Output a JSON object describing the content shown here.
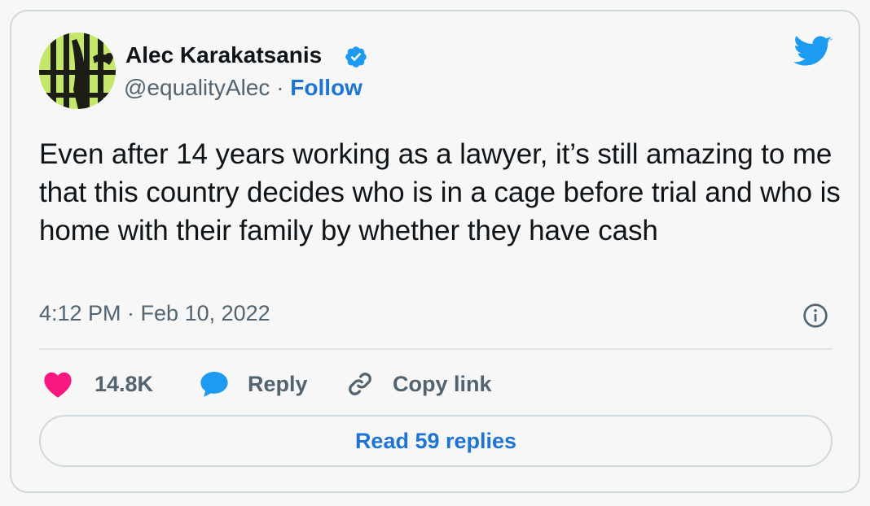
{
  "author": {
    "name": "Alec Karakatsanis",
    "handle": "@equalityAlec",
    "separator": "·",
    "follow_label": "Follow"
  },
  "tweet": {
    "text": "Even after 14 years working as a lawyer, it’s still amazing to me that this country decides who is in a cage before trial and who is home with their family by whether they have cash",
    "timestamp": "4:12 PM · Feb 10, 2022"
  },
  "actions": {
    "likes_count": "14.8K",
    "reply_label": "Reply",
    "copy_link_label": "Copy link"
  },
  "read_replies_label": "Read 59 replies",
  "colors": {
    "accent": "#1d74d3",
    "twitter_blue": "#1d9bf0",
    "like": "#f91880",
    "muted_text": "#536471",
    "border": "#cfd9de"
  },
  "icons": [
    "verified-badge-icon",
    "twitter-bird-icon",
    "info-icon",
    "heart-icon",
    "reply-bubble-icon",
    "link-icon"
  ]
}
